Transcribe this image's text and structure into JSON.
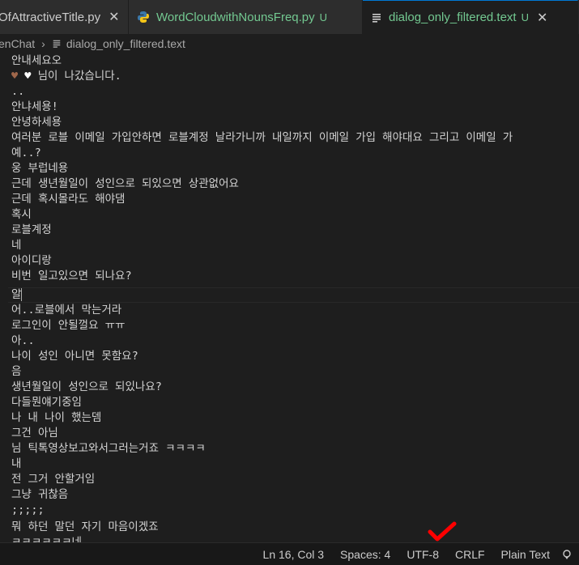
{
  "tabs": [
    {
      "label": "OfAttractiveTitle.py"
    },
    {
      "label": "WordCloudwithNounsFreq.py",
      "badge": "U"
    },
    {
      "label": "dialog_only_filtered.text",
      "badge": "U"
    }
  ],
  "breadcrumb": {
    "folder": "enChat",
    "file": "dialog_only_filtered.text"
  },
  "lines": [
    "안내세요오",
    "님이 나갔습니다.",
    "..",
    "안냐세용!",
    "안녕하세용",
    "여러분 로블 이메일 가입안하면 로블계정 날라가니까 내일까지 이메일 가입 해야대요 그리고 이메일 가",
    "예..?",
    "웅 부럽네용",
    "근데 생년월일이 성인으로 되있으면 상관없어요",
    "근데 혹시몰라도 해야댐",
    "혹시",
    "로블계정",
    "네",
    "아이디랑",
    "비번 일고있으면 되나요?",
    "알",
    "어..로블에서 막는거라",
    "로그인이 안될껄요 ㅠㅠ",
    "아..",
    "나이 성인 아니면 못함요?",
    "음",
    "생년월일이 성인으로 되있나요?",
    "다들뭔얘기중임",
    "나 내 나이 했는뎀",
    "그건 아님",
    "님 틱톡영상보고와서그러는거죠 ㅋㅋㅋㅋ",
    "내",
    "전 그거 안할거임",
    "그냥 귀찮음",
    ";;;;;",
    "뭐 하던 말던 자기 마음이겠죠",
    "ㅋㅋㅋㅋㅋㅋ네"
  ],
  "status": {
    "position": "Ln 16, Col 3",
    "spaces": "Spaces: 4",
    "encoding": "UTF-8",
    "eol": "CRLF",
    "language": "Plain Text"
  },
  "colors": {
    "accent": "#0078d4",
    "modified": "#73c991",
    "checkmark": "#ff0000"
  }
}
